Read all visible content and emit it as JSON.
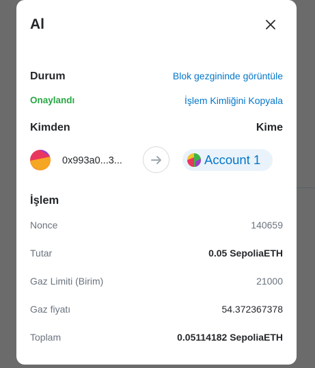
{
  "modal": {
    "title": "Al",
    "close_icon": "close-icon"
  },
  "status_section": {
    "label": "Durum",
    "explorer_link": "Blok gezgininde görüntüle",
    "status_value": "Onaylandı",
    "copy_tx_link": "İşlem Kimliğini Kopyala",
    "status_color": "#28a745"
  },
  "parties": {
    "from_label": "Kimden",
    "to_label": "Kime",
    "from_address": "0x993a0...3...",
    "arrow_icon": "arrow-right-icon",
    "to_account": "Account 1"
  },
  "transaction": {
    "title": "İşlem",
    "rows": [
      {
        "label": "Nonce",
        "value": "140659"
      },
      {
        "label": "Tutar",
        "value": "0.05 SepoliaETH"
      },
      {
        "label": "Gaz Limiti (Birim)",
        "value": "21000"
      },
      {
        "label": "Gaz fiyatı",
        "value": "54.372367378"
      },
      {
        "label": "Toplam",
        "value": "0.05114182 SepoliaETH"
      }
    ]
  },
  "colors": {
    "link": "#0376c9",
    "text": "#24272a",
    "muted": "#6a737d",
    "pill_bg": "#eaf3fb"
  }
}
